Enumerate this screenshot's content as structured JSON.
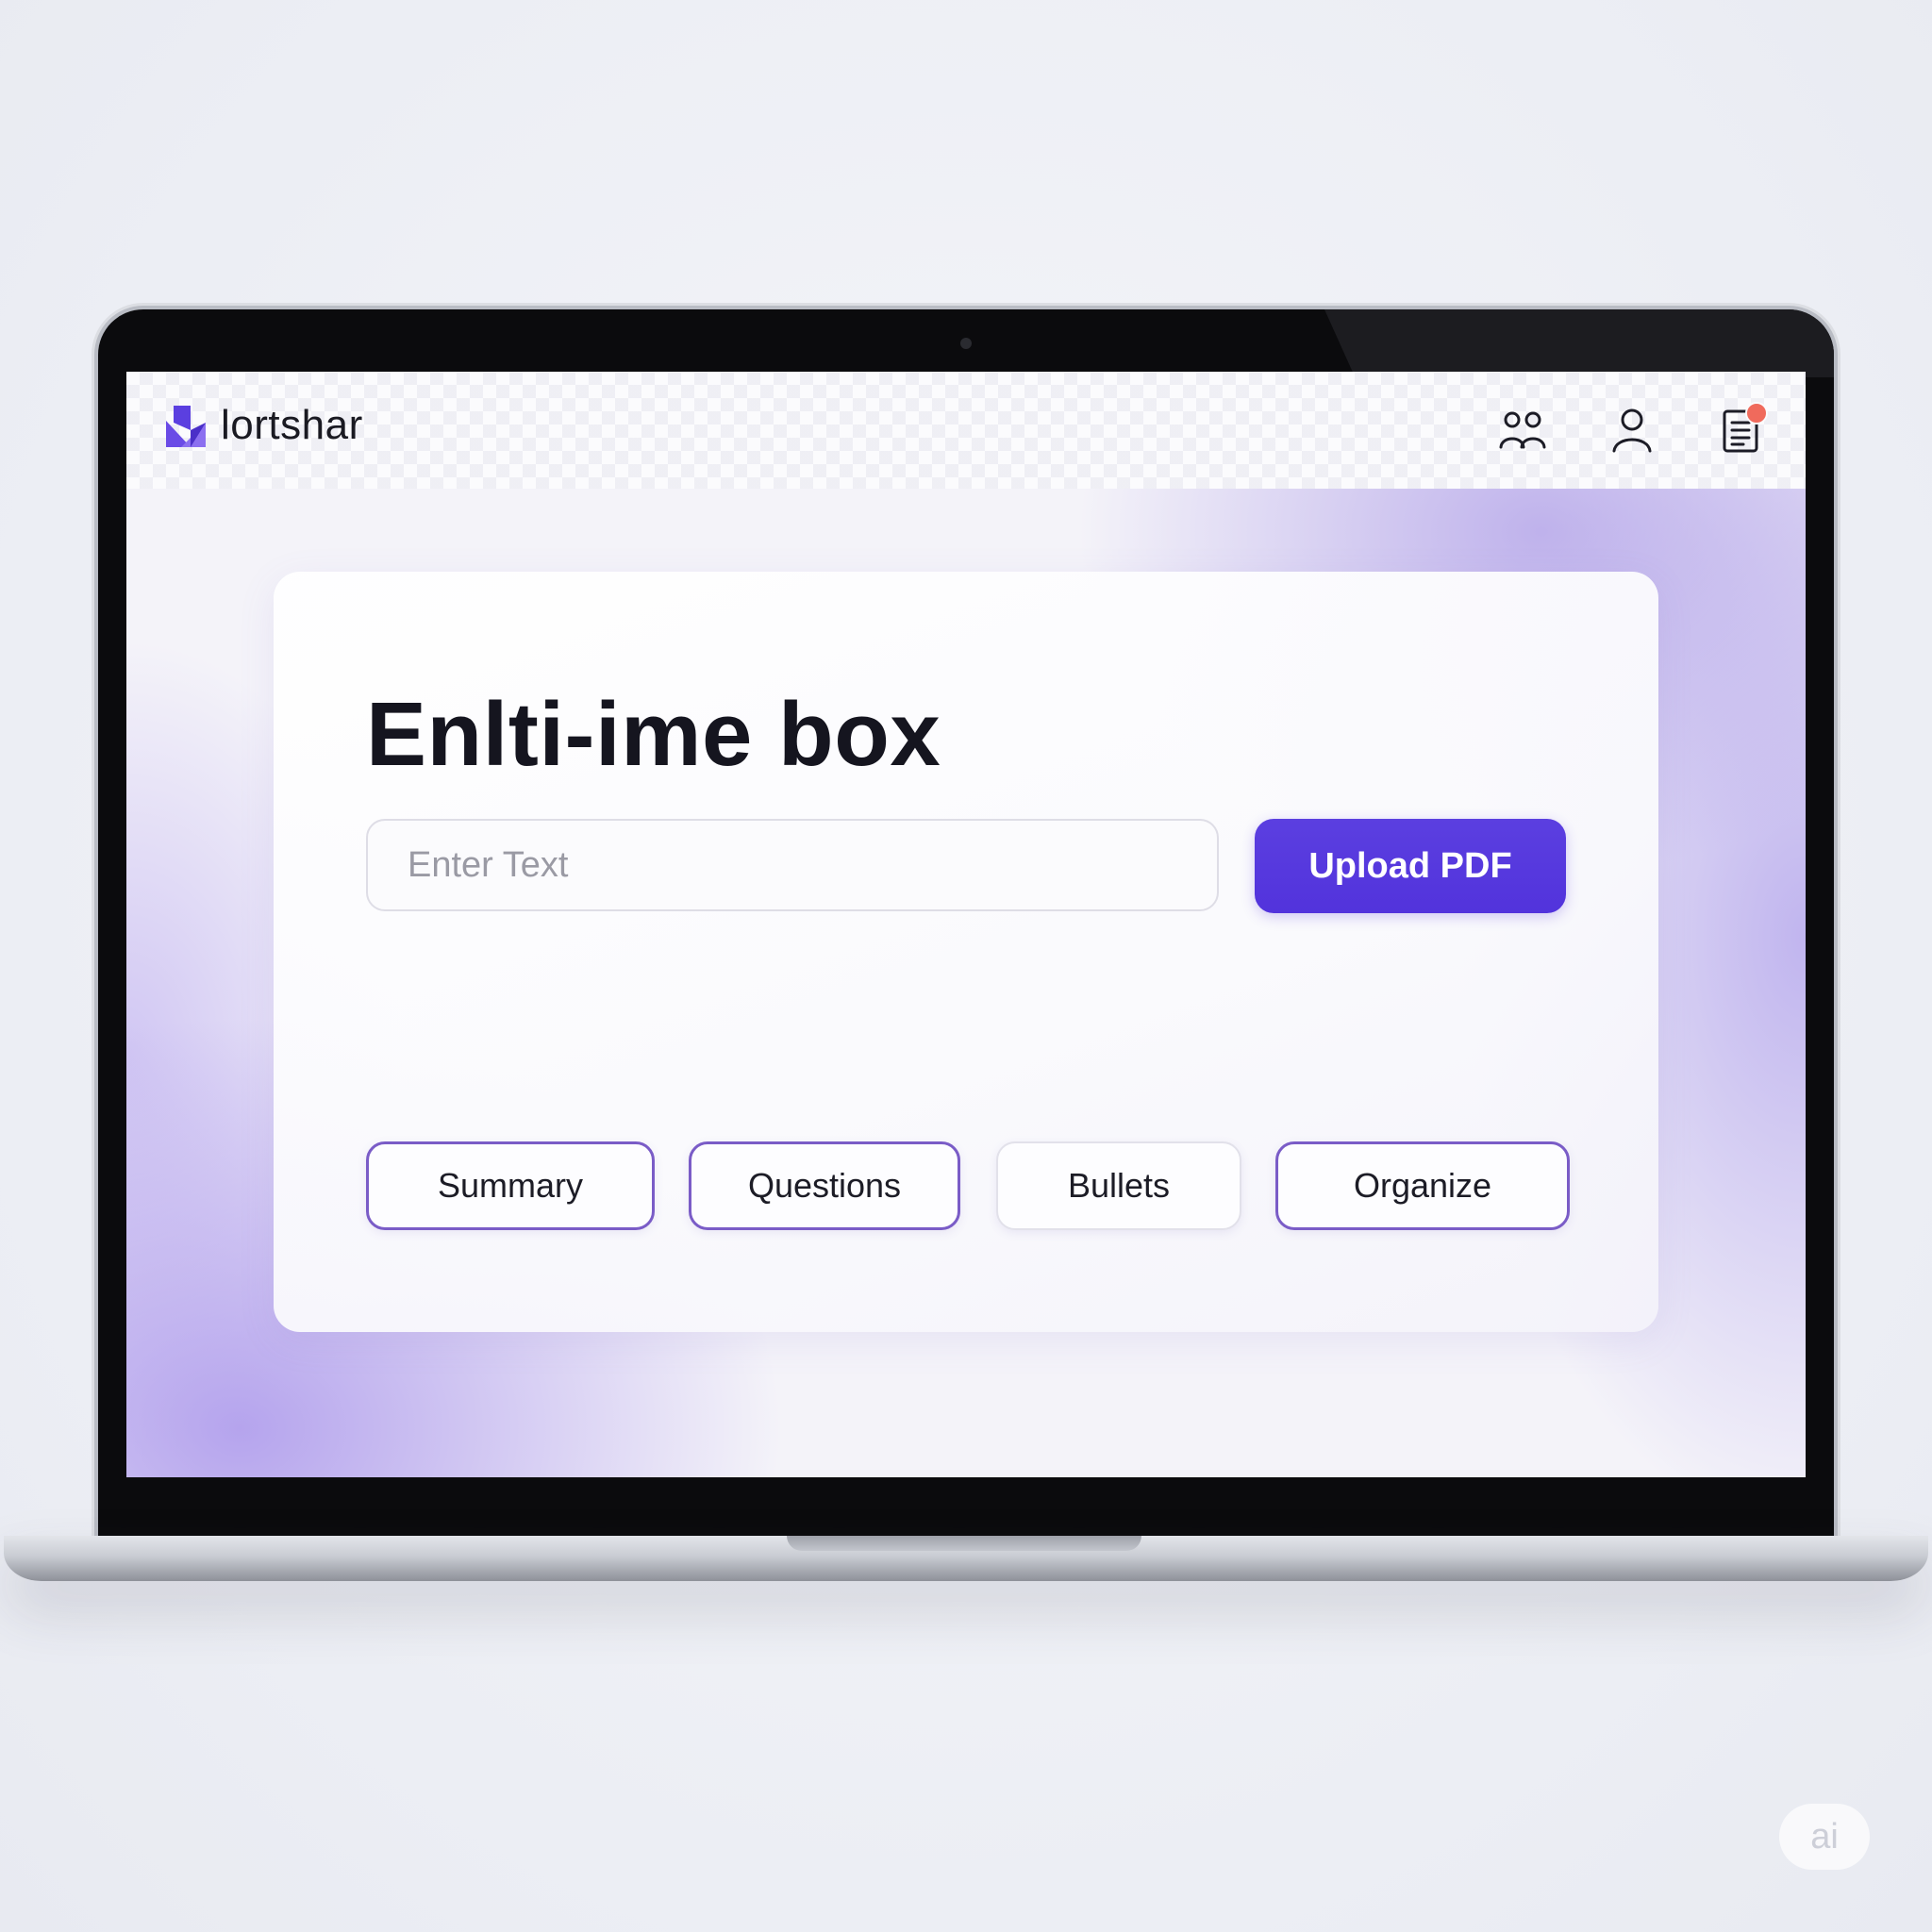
{
  "brand": {
    "name": "lortshar"
  },
  "header": {
    "icons": [
      "people-icon",
      "user-icon",
      "document-icon"
    ],
    "notification_color": "#f06a5c"
  },
  "main": {
    "title": "Enlti-ime box",
    "input": {
      "placeholder": "Enter Text",
      "value": ""
    },
    "upload_button_label": "Upload PDF",
    "actions": [
      {
        "label": "Summary"
      },
      {
        "label": "Questions"
      },
      {
        "label": "Bullets"
      },
      {
        "label": "Organize"
      }
    ]
  },
  "colors": {
    "accent": "#5233dc",
    "chip_border": "#7a5cc7",
    "brand_logo": "#5b3fe0"
  },
  "watermark": "ai"
}
